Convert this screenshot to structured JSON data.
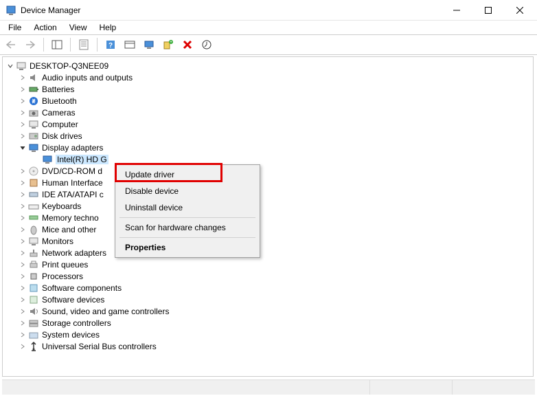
{
  "window": {
    "title": "Device Manager"
  },
  "menu": {
    "file": "File",
    "action": "Action",
    "view": "View",
    "help": "Help"
  },
  "tree": {
    "root": "DESKTOP-Q3NEE09",
    "items": [
      "Audio inputs and outputs",
      "Batteries",
      "Bluetooth",
      "Cameras",
      "Computer",
      "Disk drives",
      "Display adapters",
      "DVD/CD-ROM d",
      "Human Interface",
      "IDE ATA/ATAPI c",
      "Keyboards",
      "Memory techno",
      "Mice and other",
      "Monitors",
      "Network adapters",
      "Print queues",
      "Processors",
      "Software components",
      "Software devices",
      "Sound, video and game controllers",
      "Storage controllers",
      "System devices",
      "Universal Serial Bus controllers"
    ],
    "selected_child": "Intel(R) HD G"
  },
  "context_menu": {
    "update": "Update driver",
    "disable": "Disable device",
    "uninstall": "Uninstall device",
    "scan": "Scan for hardware changes",
    "properties": "Properties"
  }
}
